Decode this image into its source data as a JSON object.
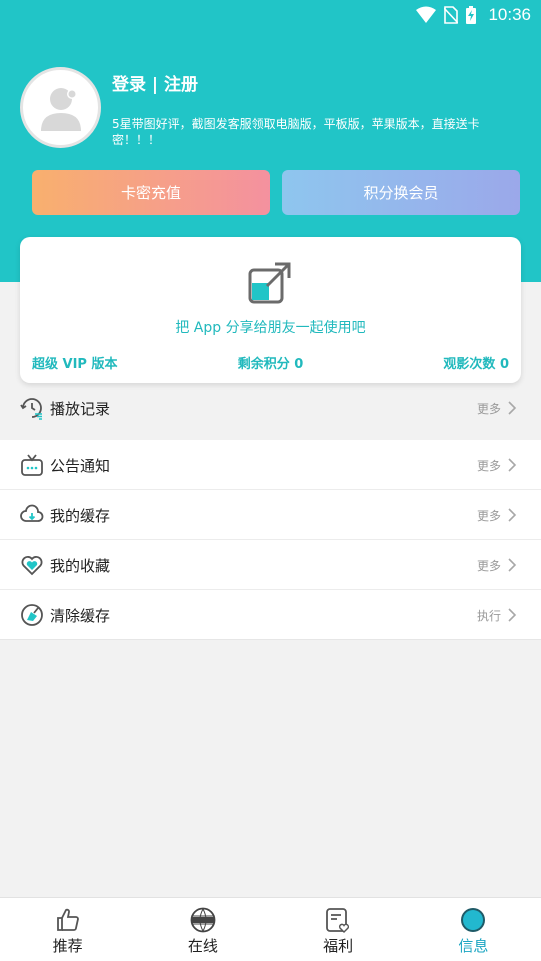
{
  "status_bar": {
    "time": "10:36"
  },
  "profile": {
    "login_label": "登录 | 注册",
    "promo": "5星带图好评，截图发客服领取电脑版，平板版，苹果版本，直接送卡密！！！"
  },
  "buttons": {
    "card_recharge": "卡密充值",
    "points_exchange": "积分换会员"
  },
  "share_card": {
    "text": "把 App 分享给朋友一起使用吧",
    "vip": "超级 VIP 版本",
    "points": "剩余积分 0",
    "views": "观影次数 0"
  },
  "history": {
    "label": "播放记录",
    "action": "更多"
  },
  "menu": [
    {
      "label": "公告通知",
      "action": "更多",
      "icon": "notice-icon"
    },
    {
      "label": "我的缓存",
      "action": "更多",
      "icon": "cloud-download-icon"
    },
    {
      "label": "我的收藏",
      "action": "更多",
      "icon": "heart-icon"
    },
    {
      "label": "清除缓存",
      "action": "执行",
      "icon": "broom-icon"
    }
  ],
  "nav": [
    {
      "label": "推荐",
      "icon": "thumbs-up-icon"
    },
    {
      "label": "在线",
      "icon": "online-globe-icon"
    },
    {
      "label": "福利",
      "icon": "gift-note-icon"
    },
    {
      "label": "信息",
      "icon": "info-circle-icon"
    }
  ],
  "colors": {
    "accent": "#21c5c7",
    "link": "#21b9bd",
    "active_nav": "#1aa5c2"
  }
}
